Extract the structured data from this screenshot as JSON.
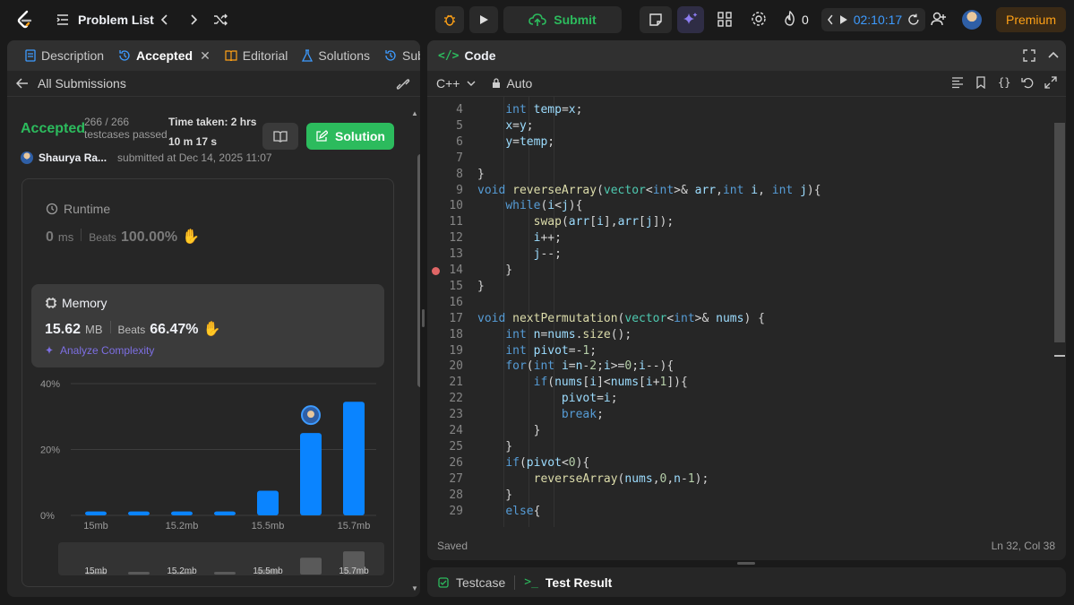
{
  "topbar": {
    "problem_list": "Problem List",
    "submit": "Submit",
    "streak": "0",
    "timer": "02:10:17",
    "premium": "Premium"
  },
  "left_tabs": [
    {
      "label": "Description"
    },
    {
      "label": "Accepted"
    },
    {
      "label": "Editorial"
    },
    {
      "label": "Solutions"
    },
    {
      "label": "Submi"
    }
  ],
  "submission": {
    "back_label": "All Submissions",
    "status": "Accepted",
    "testcases": "266 / 266",
    "testcases_label": "testcases passed",
    "time_taken_label": "Time taken: 2 hrs",
    "time_taken_rest": "10 m 17 s",
    "solution_label": "Solution",
    "author": "Shaurya Ra...",
    "submitted_at": "submitted at Dec 14, 2025 11:07"
  },
  "runtime": {
    "title": "Runtime",
    "value": "0",
    "unit": "ms",
    "beats_label": "Beats",
    "beats_value": "100.00%"
  },
  "memory": {
    "title": "Memory",
    "value": "15.62",
    "unit": "MB",
    "beats_label": "Beats",
    "beats_value": "66.47%",
    "analyze": "Analyze Complexity"
  },
  "chart_data": {
    "type": "bar",
    "yticks": [
      "40%",
      "20%",
      "0%"
    ],
    "ylim": [
      0,
      40
    ],
    "x_tick_labels": [
      "15mb",
      "15.2mb",
      "15.5mb",
      "15.7mb"
    ],
    "values": [
      1.2,
      1.2,
      1.2,
      1.2,
      7.5,
      25,
      34.5
    ],
    "highlight_index": 5,
    "accent": "#0a84ff",
    "overview_labels": [
      "15mb",
      "15.2mb",
      "15.5mb",
      "15.7mb"
    ]
  },
  "code": {
    "title": "Code",
    "language": "C++",
    "mode": "Auto",
    "status": "Saved",
    "cursor": "Ln 32, Col 38",
    "lines": [
      {
        "n": "4",
        "html": "    <span class='kw'>int</span> <span class='var'>temp</span>=<span class='var'>x</span>;"
      },
      {
        "n": "5",
        "html": "    <span class='var'>x</span>=<span class='var'>y</span>;"
      },
      {
        "n": "6",
        "html": "    <span class='var'>y</span>=<span class='var'>temp</span>;"
      },
      {
        "n": "7",
        "html": ""
      },
      {
        "n": "8",
        "html": "}"
      },
      {
        "n": "9",
        "html": "<span class='kw'>void</span> <span class='fn'>reverseArray</span>(<span class='ty'>vector</span>&lt;<span class='kw'>int</span>&gt;&amp; <span class='var'>arr</span>,<span class='kw'>int</span> <span class='var'>i</span>, <span class='kw'>int</span> <span class='var'>j</span>){"
      },
      {
        "n": "10",
        "html": "    <span class='kw'>while</span>(<span class='var'>i</span>&lt;<span class='var'>j</span>){"
      },
      {
        "n": "11",
        "html": "        <span class='fn'>swap</span>(<span class='var'>arr</span>[<span class='var'>i</span>],<span class='var'>arr</span>[<span class='var'>j</span>]);"
      },
      {
        "n": "12",
        "html": "        <span class='var'>i</span>++;"
      },
      {
        "n": "13",
        "html": "        <span class='var'>j</span>--;"
      },
      {
        "n": "14",
        "html": "    }"
      },
      {
        "n": "15",
        "html": "}"
      },
      {
        "n": "16",
        "html": ""
      },
      {
        "n": "17",
        "html": "<span class='kw'>void</span> <span class='fn'>nextPermutation</span>(<span class='ty'>vector</span>&lt;<span class='kw'>int</span>&gt;&amp; <span class='var'>nums</span>) {"
      },
      {
        "n": "18",
        "html": "    <span class='kw'>int</span> <span class='var'>n</span>=<span class='var'>nums</span>.<span class='fn'>size</span>();"
      },
      {
        "n": "19",
        "html": "    <span class='kw'>int</span> <span class='var'>pivot</span>=-<span class='num'>1</span>;"
      },
      {
        "n": "20",
        "html": "    <span class='kw'>for</span>(<span class='kw'>int</span> <span class='var'>i</span>=<span class='var'>n</span>-<span class='num'>2</span>;<span class='var'>i</span>&gt;=<span class='num'>0</span>;<span class='var'>i</span>--){"
      },
      {
        "n": "21",
        "html": "        <span class='kw'>if</span>(<span class='var'>nums</span>[<span class='var'>i</span>]&lt;<span class='var'>nums</span>[<span class='var'>i</span>+<span class='num'>1</span>]){"
      },
      {
        "n": "22",
        "html": "            <span class='var'>pivot</span>=<span class='var'>i</span>;"
      },
      {
        "n": "23",
        "html": "            <span class='kw'>break</span>;"
      },
      {
        "n": "24",
        "html": "        }"
      },
      {
        "n": "25",
        "html": "    }"
      },
      {
        "n": "26",
        "html": "    <span class='kw'>if</span>(<span class='var'>pivot</span>&lt;<span class='num'>0</span>){"
      },
      {
        "n": "27",
        "html": "        <span class='fn'>reverseArray</span>(<span class='var'>nums</span>,<span class='num'>0</span>,<span class='var'>n</span>-<span class='num'>1</span>);"
      },
      {
        "n": "28",
        "html": "    }"
      },
      {
        "n": "29",
        "html": "    <span class='kw'>else</span>{"
      }
    ],
    "breakpoint_line": "14"
  },
  "bottom": {
    "testcase": "Testcase",
    "test_result": "Test Result"
  }
}
